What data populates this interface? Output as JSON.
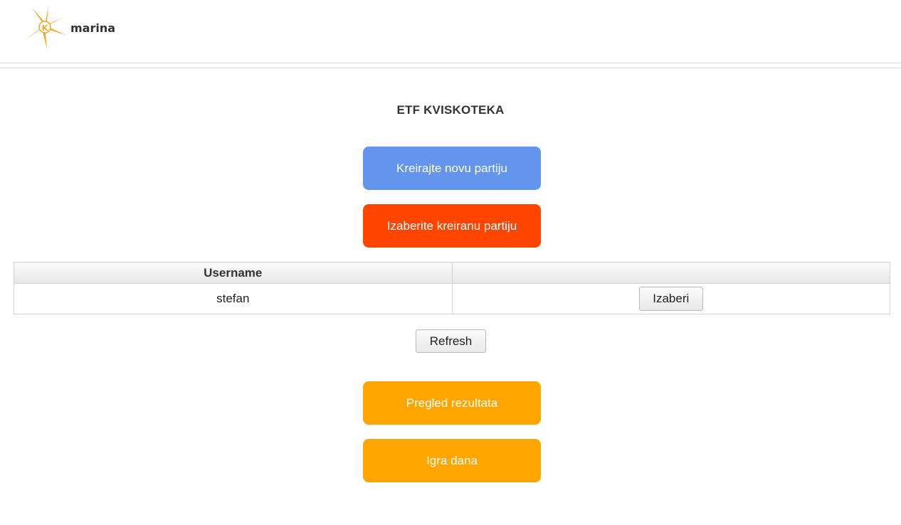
{
  "header": {
    "user_name": "marina",
    "logo_icon": "etf-k-logo-icon",
    "logo_letter": "K"
  },
  "page": {
    "title": "ETF KVISKOTEKA"
  },
  "actions": {
    "create_label": "Kreirajte novu partiju",
    "choose_label": "Izaberite kreiranu partiju",
    "results_label": "Pregled rezultata",
    "daily_label": "Igra dana",
    "refresh_label": "Refresh"
  },
  "table": {
    "headers": [
      "Username",
      ""
    ],
    "rows": [
      {
        "username": "stefan",
        "action_label": "Izaberi"
      }
    ]
  },
  "colors": {
    "create": "#6495ed",
    "choose": "#ff4500",
    "orange": "#ffa500",
    "logo": "#f5a623"
  }
}
